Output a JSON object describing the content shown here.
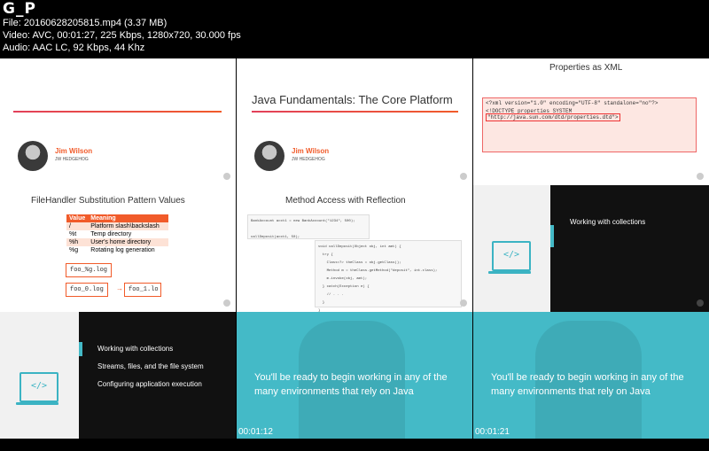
{
  "header": {
    "title": "G_P",
    "file_line": "File: 20160628205815.mp4 (3.37 MB)",
    "video_line": "Video: AVC, 00:01:27, 225 Kbps, 1280x720, 30.000 fps",
    "audio_line": "Audio: AAC LC, 92 Kbps, 44 Khz"
  },
  "tiles": {
    "t1": {
      "author": "Jim Wilson",
      "company": "JW HEDGEHOG"
    },
    "t2": {
      "title": "Java Fundamentals: The Core Platform",
      "author": "Jim Wilson",
      "company": "JW HEDGEHOG"
    },
    "t3": {
      "title": "Properties as XML",
      "xml_line1": "<?xml version=\"1.0\" encoding=\"UTF-8\" standalone=\"no\"?>",
      "xml_line2_prefix": "<!DOCTYPE properties SYSTEM ",
      "xml_line2_hl": "\"http://java.sun.com/dtd/properties.dtd\">"
    },
    "t4": {
      "title": "FileHandler Substitution Pattern Values",
      "col_value": "Value",
      "col_meaning": "Meaning",
      "rows": [
        {
          "value": "/",
          "meaning": "Platform slash\\backslash"
        },
        {
          "value": "%t",
          "meaning": "Temp directory"
        },
        {
          "value": "%h",
          "meaning": "User's home directory"
        },
        {
          "value": "%g",
          "meaning": "Rotating log generation"
        }
      ],
      "box1": "foo_%g.log",
      "box2": "foo_0.log",
      "box3": "foo_1.lo"
    },
    "t5": {
      "title": "Method Access with Reflection",
      "code1": "BankAccount acct1 = new BankAccount(\"1234\", 500);\n\ncallDeposit(acct1, 50);",
      "code2": "void callDeposit(Object obj, int amt) {\n  try {\n    Class<?> theClass = obj.getClass();\n    Method m = theClass.getMethod(\"deposit\", int.class);\n    m.invoke(obj, amt);\n  } catch(Exception e) {\n    // . . .\n  }\n}"
    },
    "t6": {
      "menu": "Working with collections",
      "icon": "</>"
    },
    "t7": {
      "items": [
        "Working with collections",
        "Streams, files, and the file system",
        "Configuring application execution"
      ],
      "icon": "</>"
    },
    "t8": {
      "text": "You'll be ready to begin working in any of the many environments that rely on Java",
      "timestamp": "00:01:12"
    },
    "t9": {
      "text": "You'll be ready to begin working in any of the many environments that rely on Java",
      "timestamp": "00:01:21"
    }
  },
  "colors": {
    "accent": "#f15b2a",
    "teal": "#44bac7",
    "icon": "#3bb3c3"
  }
}
